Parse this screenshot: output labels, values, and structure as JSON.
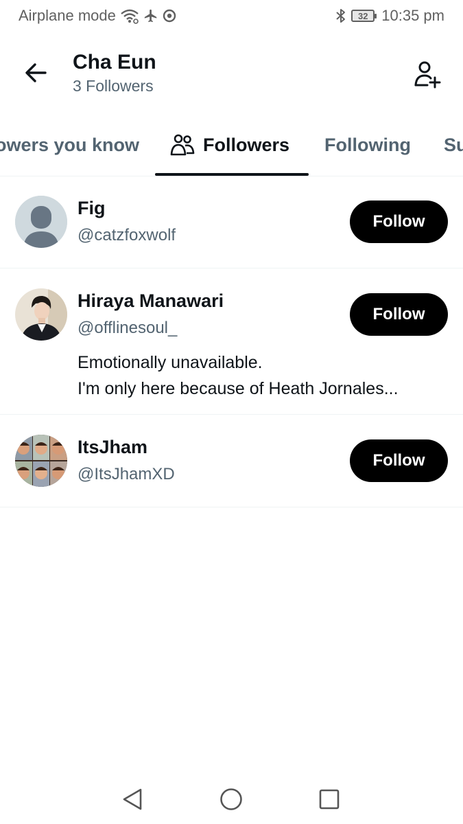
{
  "status_bar": {
    "left_text": "Airplane mode",
    "battery": "32",
    "time": "10:35 pm",
    "icons": [
      "wifi-icon",
      "airplane-icon",
      "chrome-icon",
      "bluetooth-icon",
      "battery-icon"
    ]
  },
  "header": {
    "title": "Cha Eun",
    "subtitle": "3 Followers",
    "back_icon": "arrow-left-icon",
    "add_icon": "add-user-icon"
  },
  "tabs": [
    {
      "label": "Followers you know",
      "visible_label": "owers you know",
      "active": false
    },
    {
      "label": "Followers",
      "active": true,
      "icon": "people-icon"
    },
    {
      "label": "Following",
      "active": false
    },
    {
      "label": "Subscriptions",
      "visible_label": "Su",
      "active": false
    }
  ],
  "users": [
    {
      "name": "Fig",
      "handle": "@catzfoxwolf",
      "bio_lines": [],
      "avatar": "default-avatar",
      "button": "Follow"
    },
    {
      "name": "Hiraya Manawari",
      "handle": "@offlinesoul_",
      "bio_lines": [
        "Emotionally unavailable.",
        "I'm only here because of Heath Jornales..."
      ],
      "avatar": "photo-avatar",
      "button": "Follow"
    },
    {
      "name": "ItsJham",
      "handle": "@ItsJhamXD",
      "bio_lines": [],
      "avatar": "collage-avatar",
      "button": "Follow"
    }
  ],
  "nav_bar": {
    "icons": [
      "back-triangle-icon",
      "home-circle-icon",
      "recents-square-icon"
    ]
  },
  "colors": {
    "primary_text": "#0f1419",
    "secondary_text": "#536471",
    "button_bg": "#000000",
    "divider": "#eff3f4"
  }
}
